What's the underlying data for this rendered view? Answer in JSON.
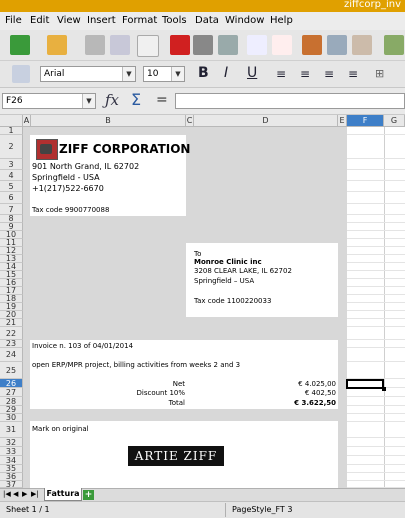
{
  "window": {
    "title": "ziffcorp_inv"
  },
  "menu": [
    "File",
    "Edit",
    "View",
    "Insert",
    "Format",
    "Tools",
    "Data",
    "Window",
    "Help"
  ],
  "toolbar2": {
    "font_name": "Arial",
    "font_size": "10"
  },
  "formula_bar": {
    "cell_ref": "F26",
    "content": ""
  },
  "columns": [
    "A",
    "B",
    "C",
    "D",
    "E",
    "F",
    "G"
  ],
  "active_column": "F",
  "active_row": "26",
  "rows": [
    "1",
    "2",
    "3",
    "4",
    "5",
    "6",
    "7",
    "8",
    "9",
    "10",
    "11",
    "12",
    "13",
    "14",
    "15",
    "16",
    "17",
    "18",
    "19",
    "20",
    "21",
    "22",
    "23",
    "24",
    "25",
    "26",
    "27",
    "28",
    "29",
    "30",
    "31",
    "32",
    "33",
    "34",
    "35",
    "36",
    "37"
  ],
  "invoice": {
    "company": "ZIFF CORPORATION",
    "addr1": "901 North Grand, IL 62702",
    "addr2": "Springfield - USA",
    "phone": "+1(217)522-6670",
    "tax_code": "Tax code  9900770088",
    "to_label": "To",
    "to_name": "Monroe Clinic inc",
    "to_addr1": "3208 CLEAR LAKE, IL 62702",
    "to_addr2": "Springfield – USA",
    "to_tax": "Tax code  1100220033",
    "invoice_line": "Invoice n. 103 of 04/01/2014",
    "description": "open ERP/MPR project, billing activities from weeks 2 and 3",
    "net_label": "Net",
    "net_value": "€ 4.025,00",
    "discount_label": "Discount 10%",
    "discount_value": "€ 402,50",
    "total_label": "Total",
    "total_value": "€ 3.622,50",
    "mark": "Mark on original",
    "signature": "ARTIE ZIFF"
  },
  "sheet_tab": "Fattura",
  "status": {
    "sheet": "Sheet 1 / 1",
    "page_style": "PageStyle_FT 3"
  }
}
